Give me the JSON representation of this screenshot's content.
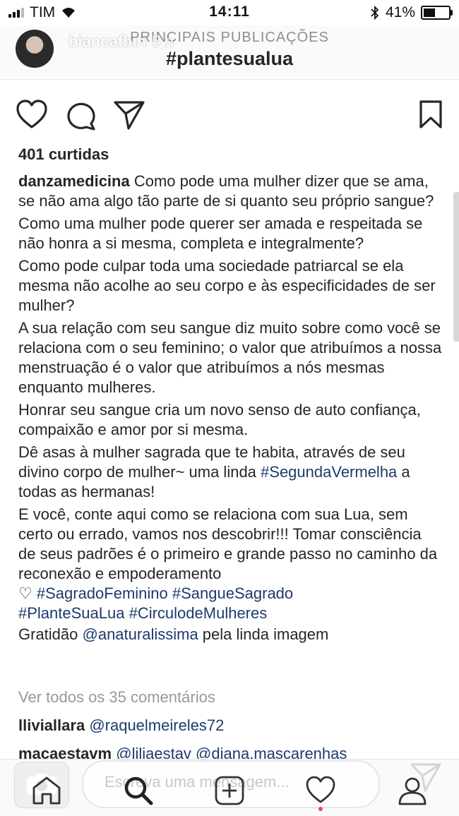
{
  "status_bar": {
    "carrier": "TIM",
    "time": "14:11",
    "battery": "41%",
    "battery_level": 0.41
  },
  "story": {
    "username": "biancafbin",
    "age": "5 h"
  },
  "header": {
    "subtitle": "PRINCIPAIS PUBLICAÇÕES",
    "title": "#plantesualua"
  },
  "post": {
    "likes": "401 curtidas",
    "caption": {
      "author": "danzamedicina",
      "p1": "Como pode uma mulher dizer que se ama, se não ama algo tão parte de si quanto seu próprio sangue?",
      "p2": "Como uma mulher pode querer ser amada e respeitada se não honra a si mesma, completa e integralmente?",
      "p3": "Como pode culpar toda uma sociedade patriarcal se ela mesma não acolhe ao seu corpo e às especificidades de ser mulher?",
      "p4": "A sua relação com seu sangue diz muito sobre como você se relaciona com o seu feminino; o valor que atribuímos a nossa menstruação é o valor que atribuímos a nós mesmas enquanto mulheres.",
      "p5": "Honrar seu sangue cria um novo senso de auto confiança, compaixão e amor por si mesma.",
      "p6_text": "Dê asas à mulher sagrada que te habita, através de seu divino corpo de mulher~ uma linda ",
      "p6_tag": "#SegundaVermelha",
      "p6_end": " a todas as hermanas!",
      "p7_text": "E você, conte aqui como se relaciona com sua Lua, sem certo ou errado, vamos nos descobrir!!! Tomar consciência de seus padrões é o primeiro e grande passo no caminho da reconexão e empoderamento",
      "heart": "♡",
      "tags": [
        "#SagradoFeminino",
        "#SangueSagrado",
        "#PlanteSuaLua",
        "#CirculodeMulheres"
      ],
      "thanks_pre": "Gratidão ",
      "thanks_mention": "@anaturalissima",
      "thanks_post": " pela linda imagem"
    },
    "view_all_comments": "Ver todos os 35 comentários",
    "comments": [
      {
        "user": "lliviallara",
        "text": "@raquelmeireles72"
      },
      {
        "user": "macaestavm",
        "text": "@liliaestav @diana.mascarenhas"
      }
    ]
  },
  "reply_bar": {
    "placeholder": "Escreva uma mensagem..."
  },
  "icons": {
    "like": "heart-icon",
    "comment": "comment-icon",
    "share": "paper-plane-icon",
    "save": "bookmark-icon",
    "camera": "camera-icon",
    "send": "send-icon",
    "home": "home-icon",
    "search": "search-icon",
    "add": "add-post-icon",
    "activity": "activity-heart-icon",
    "profile": "profile-icon"
  },
  "colors": {
    "link": "#1e3a6e",
    "text": "#262626",
    "muted": "#999999",
    "notification": "#ed4956"
  }
}
